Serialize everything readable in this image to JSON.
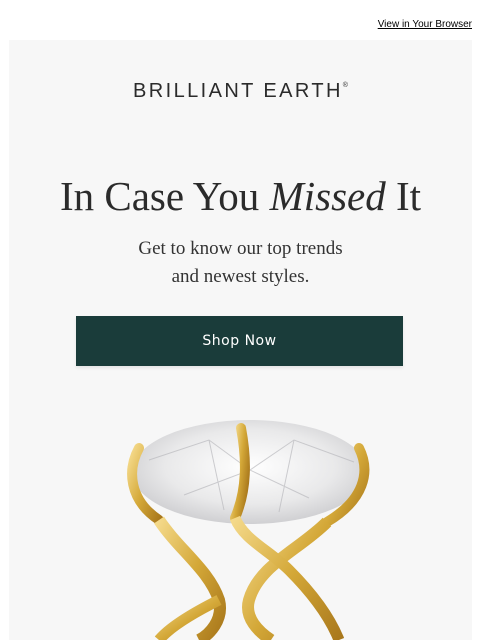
{
  "header": {
    "view_in_browser": "View in Your Browser"
  },
  "brand": {
    "name": "BRILLIANT EARTH",
    "mark": "®"
  },
  "hero": {
    "headline_pre": "In Case You ",
    "headline_em": "Missed",
    "headline_post": " It",
    "sub_line1": "Get to know our top trends",
    "sub_line2": "and newest styles.",
    "cta": "Shop Now"
  },
  "colors": {
    "button": "#1a3c3a",
    "card_bg": "#f7f7f7",
    "gold": "#d4a838"
  }
}
